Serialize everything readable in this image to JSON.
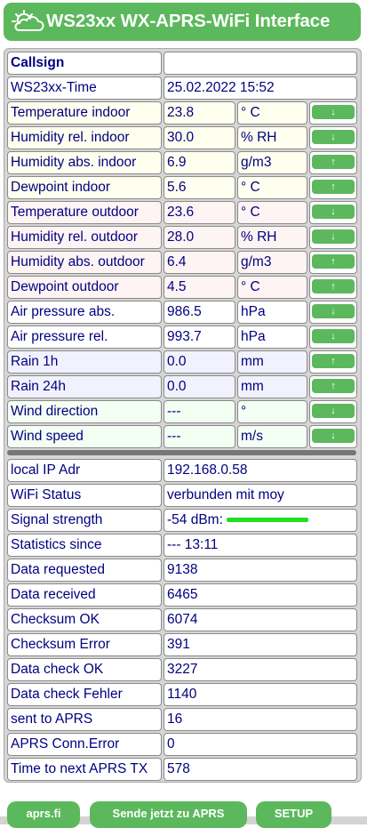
{
  "header": {
    "title": "WS23xx WX-APRS-WiFi Interface",
    "logo_icon": "cloud-sun-icon"
  },
  "callsign": {
    "label": "Callsign",
    "value": ""
  },
  "time": {
    "label": "WS23xx-Time",
    "value": "25.02.2022 15:52"
  },
  "weather_rows": [
    {
      "label": "Temperature indoor",
      "value": "23.8",
      "unit": "° C",
      "trend": "↓"
    },
    {
      "label": "Humidity rel. indoor",
      "value": "30.0",
      "unit": "% RH",
      "trend": "↓"
    },
    {
      "label": "Humidity abs. indoor",
      "value": "6.9",
      "unit": "g/m3",
      "trend": "↑"
    },
    {
      "label": "Dewpoint indoor",
      "value": "5.6",
      "unit": "° C",
      "trend": "↑"
    },
    {
      "label": "Temperature outdoor",
      "value": "23.6",
      "unit": "° C",
      "trend": "↓"
    },
    {
      "label": "Humidity rel. outdoor",
      "value": "28.0",
      "unit": "% RH",
      "trend": "↓"
    },
    {
      "label": "Humidity abs. outdoor",
      "value": "6.4",
      "unit": "g/m3",
      "trend": "↑"
    },
    {
      "label": "Dewpoint outdoor",
      "value": "4.5",
      "unit": "° C",
      "trend": "↑"
    },
    {
      "label": "Air pressure abs.",
      "value": "986.5",
      "unit": "hPa",
      "trend": "↓"
    },
    {
      "label": "Air pressure rel.",
      "value": "993.7",
      "unit": "hPa",
      "trend": "↓"
    },
    {
      "label": "Rain 1h",
      "value": "0.0",
      "unit": "mm",
      "trend": "↑"
    },
    {
      "label": "Rain 24h",
      "value": "0.0",
      "unit": "mm",
      "trend": "↑"
    },
    {
      "label": "Wind direction",
      "value": "---",
      "unit": "°",
      "trend": "↓"
    },
    {
      "label": "Wind speed",
      "value": "---",
      "unit": "m/s",
      "trend": "↓"
    }
  ],
  "status_rows": [
    {
      "label": "local IP Adr",
      "value": "192.168.0.58"
    },
    {
      "label": "WiFi Status",
      "value": "verbunden mit moy"
    },
    {
      "label": "Signal strength",
      "value": "-54 dBm:"
    },
    {
      "label": "Statistics since",
      "value": "--- 13:11"
    },
    {
      "label": "Data requested",
      "value": "9138"
    },
    {
      "label": "Data received",
      "value": "6465"
    },
    {
      "label": "Checksum OK",
      "value": "6074"
    },
    {
      "label": "Checksum Error",
      "value": "391"
    },
    {
      "label": "Data check OK",
      "value": "3227"
    },
    {
      "label": "Data check Fehler",
      "value": "1140"
    },
    {
      "label": "sent to APRS",
      "value": "16"
    },
    {
      "label": "APRS Conn.Error",
      "value": "0"
    },
    {
      "label": "Time to next APRS TX",
      "value": "578"
    }
  ],
  "buttons": {
    "aprs": "aprs.fi",
    "send": "Sende jetzt zu APRS",
    "setup": "SETUP"
  },
  "colors": {
    "accent": "#5cb85c",
    "text": "#000080",
    "signal": "#22dd22"
  }
}
